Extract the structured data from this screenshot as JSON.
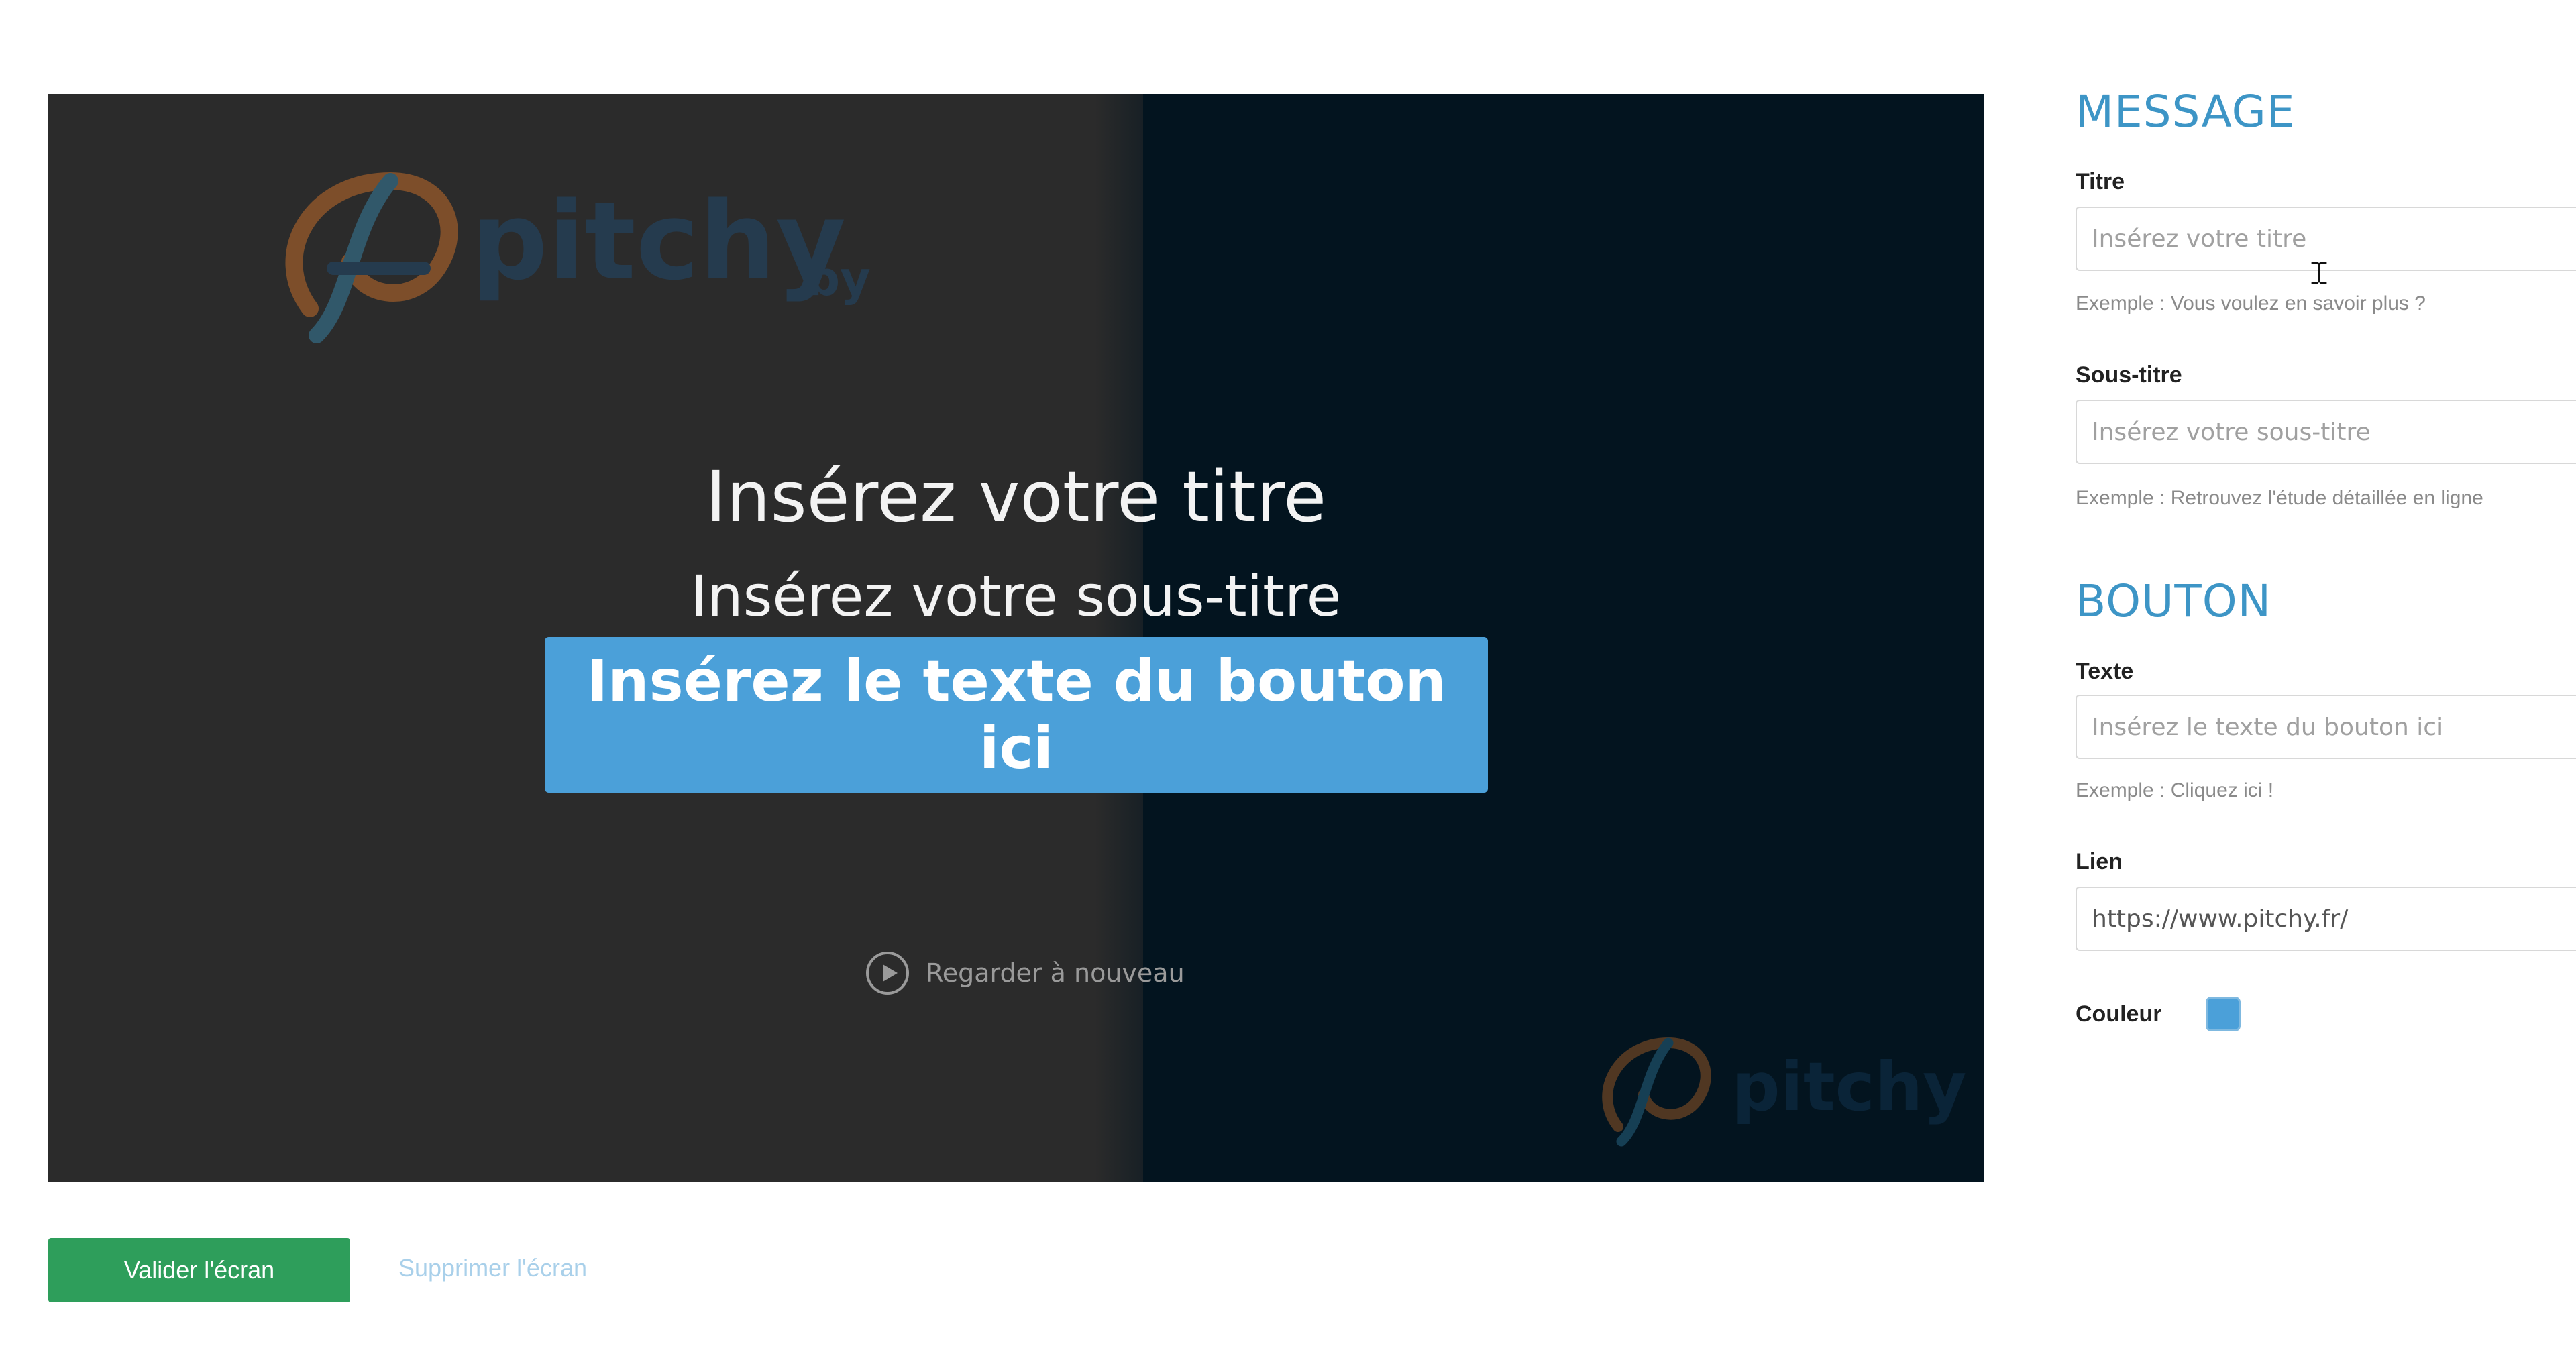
{
  "preview": {
    "logo_text": "pitchy",
    "logo_suffix": "by",
    "title": "Insérez votre titre",
    "subtitle": "Insérez votre sous-titre",
    "button_label": "Insérez le texte du bouton ici",
    "replay_label": "Regarder à nouveau",
    "colors": {
      "left_bg": "#2b2b2b",
      "right_bg": "#03141f",
      "button": "#4ba0d9"
    }
  },
  "actions": {
    "validate_label": "Valider l'écran",
    "delete_label": "Supprimer l'écran",
    "validate_color": "#2e9e5b"
  },
  "form": {
    "message_heading": "MESSAGE",
    "title_label": "Titre",
    "title_placeholder": "Insérez votre titre",
    "title_hint": "Exemple : Vous voulez en savoir plus ?",
    "subtitle_label": "Sous-titre",
    "subtitle_placeholder": "Insérez votre sous-titre",
    "subtitle_hint": "Exemple : Retrouvez l'étude détaillée en ligne",
    "button_heading": "BOUTON",
    "text_label": "Texte",
    "text_placeholder": "Insérez le texte du bouton ici",
    "text_hint": "Exemple : Cliquez ici !",
    "link_label": "Lien",
    "link_value": "https://www.pitchy.fr/",
    "color_label": "Couleur",
    "color_value": "#4ba0d9",
    "heading_color": "#3d95c6"
  }
}
